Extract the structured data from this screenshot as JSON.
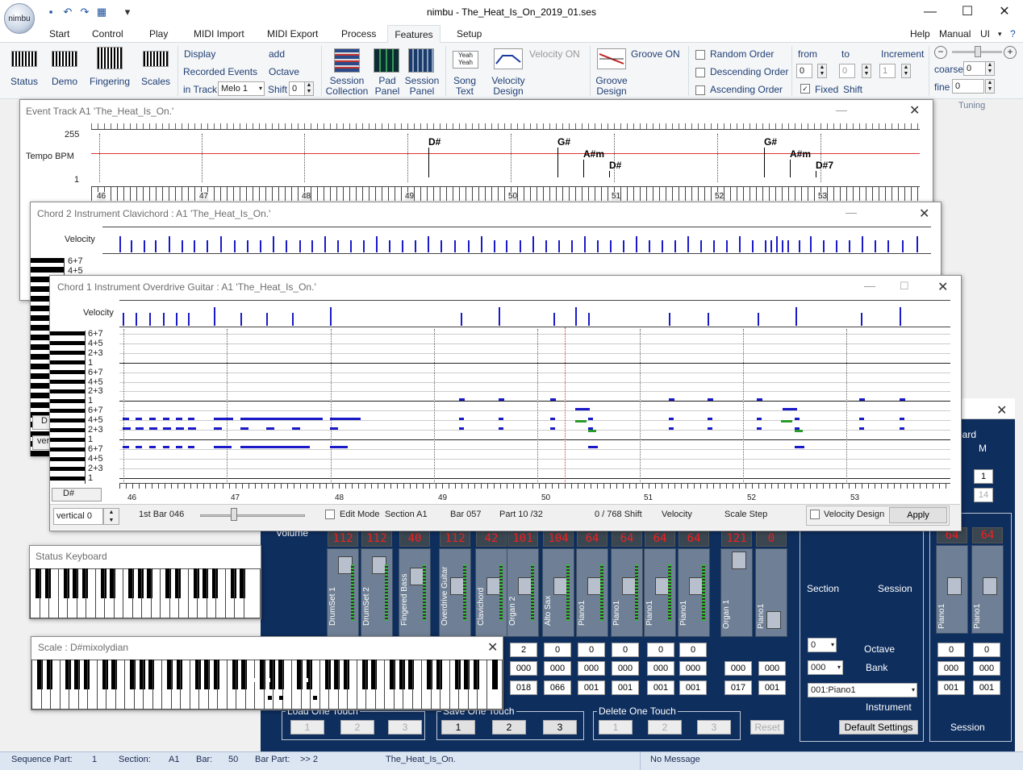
{
  "app": {
    "title": "nimbu - The_Heat_Is_On_2019_01.ses",
    "logo": "nimbu"
  },
  "quick_access": [
    "save-icon",
    "undo-icon",
    "redo-icon",
    "print-preview-icon",
    "customize-icon"
  ],
  "menu": {
    "tabs": [
      "Start",
      "Control",
      "Play",
      "MIDI Import",
      "MIDI Export",
      "Process",
      "Features",
      "Setup"
    ],
    "selected": "Features",
    "right": [
      "Help",
      "Manual",
      "UI"
    ]
  },
  "ribbon": {
    "g1": [
      "Status",
      "Demo",
      "Fingering",
      "Scales"
    ],
    "display": "Display",
    "recorded": "Recorded Events",
    "in_track": "in Track",
    "track_value": "Melo 1",
    "add": "add",
    "octave": "Octave",
    "shift": "Shift",
    "shift_value": "0",
    "g2": [
      "Session Collection",
      "Pad Panel",
      "Session Panel",
      "Song Text",
      "Velocity Design",
      "Groove Design"
    ],
    "velocity_on": "Velocity  ON",
    "groove_on": "Groove ON",
    "order": [
      "Random Order",
      "Descending Order",
      "Ascending Order"
    ],
    "from": "from",
    "to": "to",
    "increment": "Increment",
    "from_value": "0",
    "to_value": "0",
    "inc_value": "1",
    "fixed": "Fixed",
    "fshift": "Shift",
    "coarse": "coarse",
    "coarse_value": "0",
    "fine": "fine",
    "fine_value": "0",
    "tuning": "Tuning"
  },
  "event_track": {
    "title": "Event Track      A1  'The_Heat_Is_On.'",
    "tempo": "Tempo  BPM",
    "max": "255",
    "min": "1",
    "chords": [
      "D#",
      "G#",
      "A#m",
      "D#",
      "G#",
      "A#m",
      "D#7"
    ],
    "bars": [
      "46",
      "47",
      "48",
      "49",
      "50",
      "51",
      "52",
      "53"
    ]
  },
  "chord2": {
    "title": "Chord 2 Instrument  Clavichord        :   A1  'The_Heat_Is_On.'",
    "velocity": "Velocity",
    "rows": [
      "6+7",
      "4+5"
    ]
  },
  "chord1": {
    "title": "Chord 1 Instrument  Overdrive Guitar    :   A1  'The_Heat_Is_On.'",
    "velocity": "Velocity",
    "rows": [
      "6+7",
      "4+5",
      "2+3",
      "1",
      "6+7",
      "4+5",
      "2+3",
      "1",
      "6+7",
      "4+5",
      "2+3",
      "1",
      "6+7",
      "4+5",
      "2+3",
      "1"
    ],
    "key": "D#",
    "bars": [
      "46",
      "47",
      "48",
      "49",
      "50",
      "51",
      "52",
      "53"
    ],
    "bottom": {
      "vertical": "vertical 0",
      "first_bar": "1st Bar   046",
      "edit_mode": "Edit Mode",
      "section": "Section    A1",
      "bar": "Bar  057",
      "part": "Part  10 /32",
      "shift": "0  / 768 Shift",
      "velocity": "Velocity",
      "scale_step": "Scale Step",
      "velocity_design": "Velocity Design",
      "apply": "Apply"
    }
  },
  "side_labels": {
    "d": "D",
    "ver": "ver"
  },
  "status_keyboard": {
    "title": "Status Keyboard"
  },
  "scale_window": {
    "title": "Scale : D#mixolydian"
  },
  "mixer": {
    "volume": "Volume",
    "board": "oard",
    "m": "M",
    "one": "1",
    "fourteen": "14",
    "channels": [
      {
        "name": "DrumSet 1",
        "val": "112"
      },
      {
        "name": "DrumSet 2",
        "val": "112"
      },
      {
        "name": "Fingered Bass",
        "val": "40"
      },
      {
        "name": "Overdrive Guitar",
        "val": "112"
      },
      {
        "name": "Clavichord",
        "val": "42"
      },
      {
        "name": "Organ 2",
        "val": "101"
      },
      {
        "name": "Alto Sax",
        "val": "104"
      },
      {
        "name": "Piano1",
        "val": "64"
      },
      {
        "name": "Piano1",
        "val": "64"
      },
      {
        "name": "Piano1",
        "val": "64"
      },
      {
        "name": "Piano1",
        "val": "64"
      }
    ],
    "chan_extra": [
      {
        "name": "Organ 1",
        "val": "121"
      },
      {
        "name": "Piano1",
        "val": "0"
      }
    ],
    "chan_session": [
      {
        "name": "Piano1",
        "val": "64"
      },
      {
        "name": "Piano1",
        "val": "64"
      }
    ],
    "row1": [
      "2",
      "0",
      "0",
      "0",
      "0",
      "0"
    ],
    "row2": [
      "000",
      "000",
      "000",
      "000",
      "000",
      "000"
    ],
    "row3": [
      "018",
      "066",
      "001",
      "001",
      "001",
      "001"
    ],
    "extra_rows": [
      [
        "000",
        "000"
      ],
      [
        "017",
        "001"
      ]
    ],
    "sess_rows": [
      [
        "0",
        "0"
      ],
      [
        "000",
        "000"
      ],
      [
        "001",
        "001"
      ]
    ],
    "section": "Section",
    "session": "Session",
    "octave": "Octave",
    "bank": "Bank",
    "instrument": "Instrument",
    "oct_value": "0",
    "bank_value": "000",
    "inst_value": "001:Piano1",
    "default": "Default Settings",
    "session2": "Session",
    "load": "Load One Touch",
    "save": "Save One Touch",
    "delete": "Delete One Touch",
    "reset": "Reset",
    "nums": [
      "1",
      "2",
      "3"
    ]
  },
  "statusbar": {
    "seq_part": "Sequence Part:",
    "seq_val": "1",
    "section": "Section:",
    "section_val": "A1",
    "bar": "Bar:",
    "bar_val": "50",
    "bar_part": "Bar Part:",
    "bar_part_val": ">> 2",
    "file": "The_Heat_Is_On.",
    "message": "No Message"
  }
}
